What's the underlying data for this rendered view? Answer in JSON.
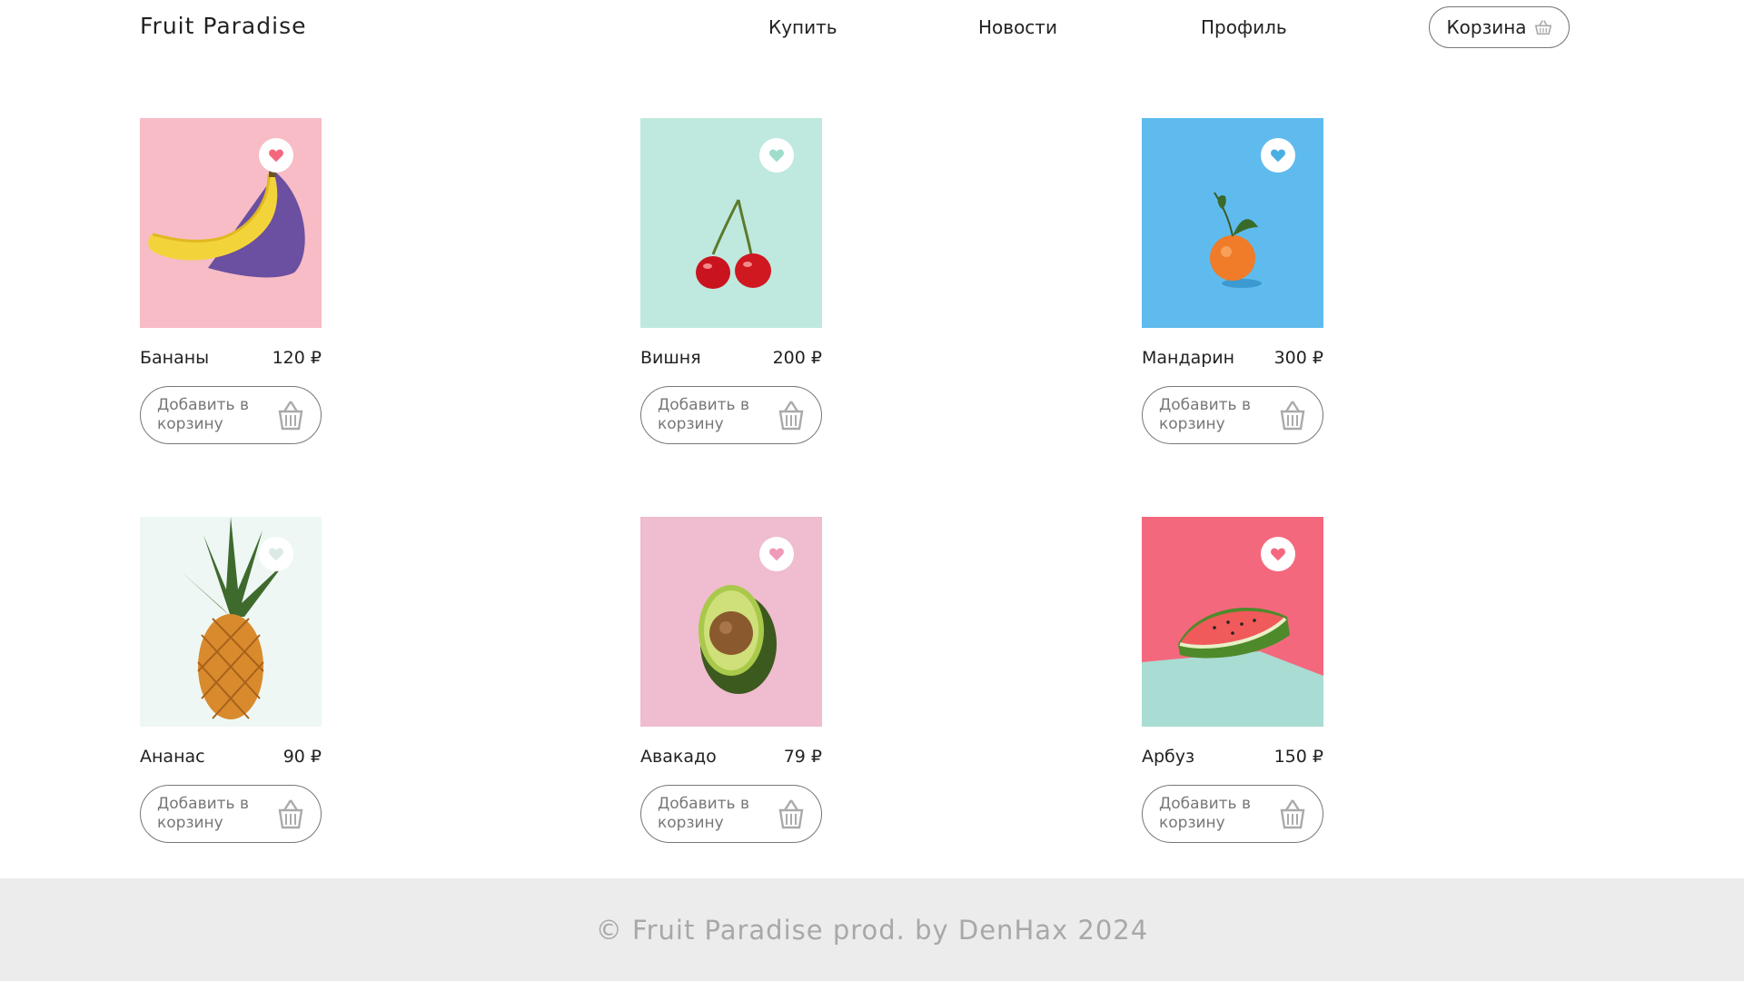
{
  "header": {
    "logo": "Fruit Paradise",
    "nav": [
      "Купить",
      "Новости",
      "Профиль"
    ],
    "cart_label": "Корзина"
  },
  "add_to_cart_label": "Добавить в корзину",
  "products": [
    {
      "name": "Бананы",
      "price": "120 ₽",
      "bg": "#f7bcc5",
      "fruit": "banana"
    },
    {
      "name": "Вишня",
      "price": "200 ₽",
      "bg": "#bfe9de",
      "fruit": "cherry"
    },
    {
      "name": "Мандарин",
      "price": "300 ₽",
      "bg": "#5fbbed",
      "fruit": "mandarin"
    },
    {
      "name": "Ананас",
      "price": "90 ₽",
      "bg": "#eef7f4",
      "fruit": "pineapple"
    },
    {
      "name": "Авакадо",
      "price": "79 ₽",
      "bg": "#f0bccf",
      "fruit": "avocado"
    },
    {
      "name": "Арбуз",
      "price": "150 ₽",
      "bg": "#f4687e",
      "fruit": "watermelon"
    }
  ],
  "footer": {
    "text": "© Fruit Paradise prod. by DenHax 2024"
  },
  "colors": {
    "heart": "#f4687e",
    "border": "#777777",
    "footer_bg": "#ececec"
  }
}
